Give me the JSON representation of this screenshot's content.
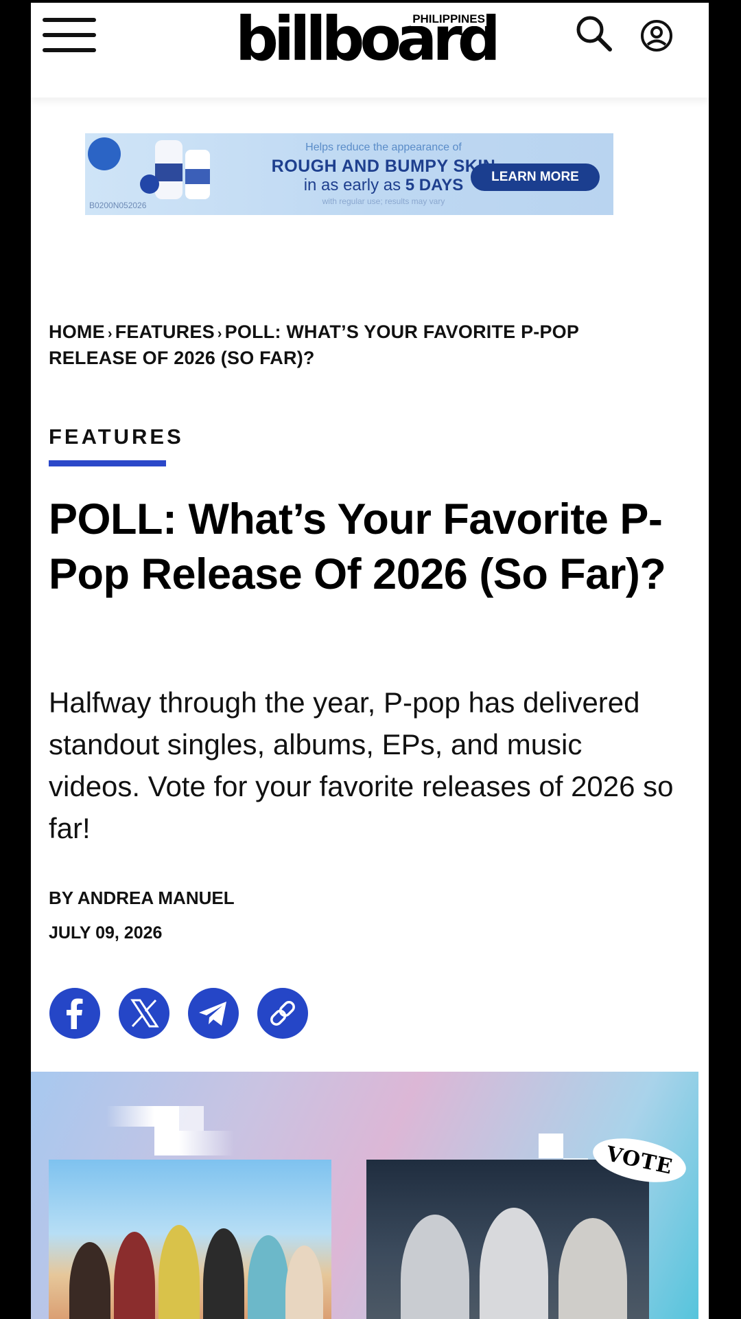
{
  "header": {
    "logo": "billboard",
    "logo_country": "PHILIPPINES"
  },
  "ad": {
    "line1": "Helps reduce the appearance of",
    "line2": "ROUGH AND BUMPY SKIN",
    "line3_prefix": "in as early as ",
    "line3_emphasis": "5 DAYS",
    "line4": "with regular use; results may vary",
    "code": "B0200N052026",
    "cta": "LEARN MORE"
  },
  "breadcrumb": {
    "items": [
      "HOME",
      "FEATURES",
      "POLL: WHAT’S YOUR FAVORITE P-POP RELEASE OF 2026 (SO FAR)?"
    ]
  },
  "article": {
    "category": "FEATURES",
    "title": "POLL: What’s Your Favorite P-Pop Release Of 2026 (So Far)?",
    "dek": "Halfway through the year, P-pop has delivered standout singles, albums, EPs, and music videos. Vote for your favorite releases of 2026 so far!",
    "byline": "BY ANDREA MANUEL",
    "date": "JULY 09, 2026"
  },
  "share": {
    "icons": [
      "facebook-icon",
      "x-icon",
      "telegram-icon",
      "link-icon"
    ]
  },
  "hero": {
    "badge": "VOTE"
  },
  "colors": {
    "accent": "#2b48c9",
    "share_button": "#2546c7",
    "ad_button": "#1b3e8f"
  }
}
